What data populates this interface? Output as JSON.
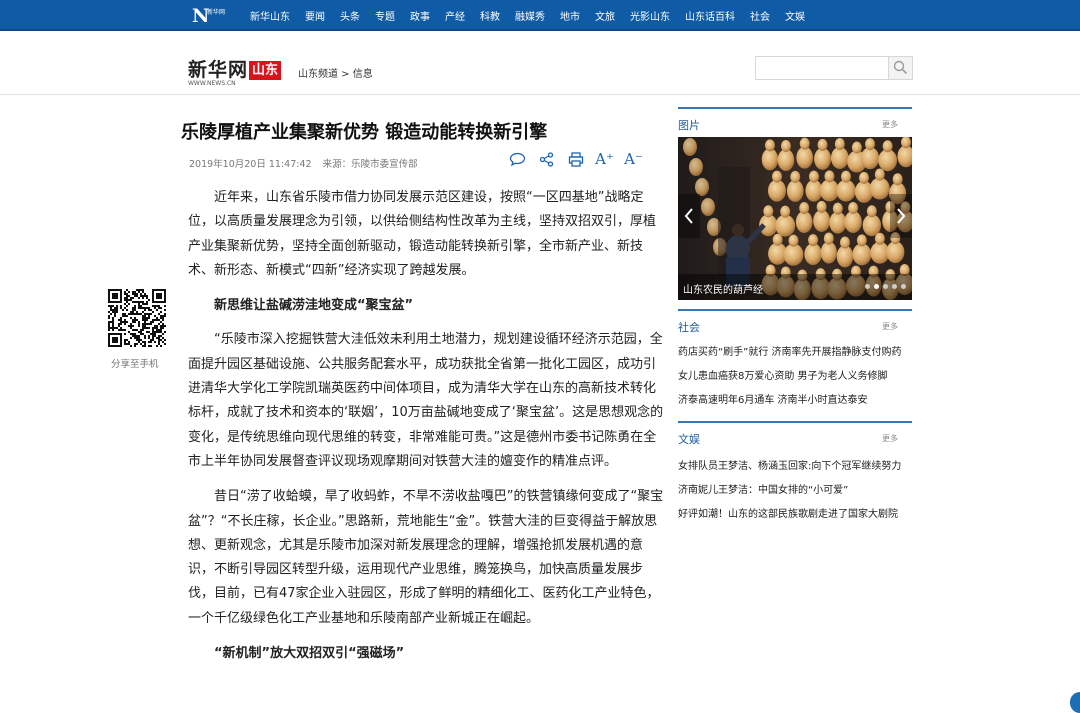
{
  "topnav": {
    "logo": {
      "mark": "N",
      "sub": "新华网"
    },
    "items": [
      "新华山东",
      "要闻",
      "头条",
      "专题",
      "政事",
      "产经",
      "科教",
      "融媒秀",
      "地市",
      "文旅",
      "光影山东",
      "山东话百科",
      "社会",
      "文娱"
    ]
  },
  "header": {
    "brand_cn": "新华网",
    "brand_region": "山东",
    "brand_url": "WWW.NEWS.CN",
    "breadcrumb": "山东频道 > 信息",
    "search_placeholder": "",
    "search_icon": "search-icon"
  },
  "article": {
    "title": "乐陵厚植产业集聚新优势 锻造动能转换新引擎",
    "date": "2019年10月20日 11:47:42",
    "source": "来源：乐陵市委宣传部",
    "tools": [
      "comment-icon",
      "share-icon",
      "print-icon",
      "font-larger-icon",
      "font-smaller-icon"
    ],
    "font_larger": "A⁺",
    "font_smaller": "A⁻",
    "paragraphs": [
      "近年来，山东省乐陵市借力协同发展示范区建设，按照“一区四基地”战略定位，以高质量发展理念为引领，以供给侧结构性改革为主线，坚持双招双引，厚植产业集聚新优势，坚持全面创新驱动，锻造动能转换新引擎，全市新产业、新技术、新形态、新模式“四新”经济实现了跨越发展。",
      "新思维让盐碱涝洼地变成“聚宝盆”",
      "“乐陵市深入挖掘铁营大洼低效未利用土地潜力，规划建设循环经济示范园，全面提升园区基础设施、公共服务配套水平，成功获批全省第一批化工园区，成功引进清华大学化工学院凯瑞英医药中间体项目，成为清华大学在山东的高新技术转化标杆，成就了技术和资本的‘联姻’，10万亩盐碱地变成了‘聚宝盆’。这是思想观念的变化，是传统思维向现代思维的转变，非常难能可贵。”这是德州市委书记陈勇在全市上半年协同发展督查评议现场观摩期间对铁营大洼的嬗变作的精准点评。",
      "昔日“涝了收蛤蟆，旱了收蚂蚱，不旱不涝收盐嘎巴”的铁营镇缘何变成了“聚宝盆”？“不长庄稼，长企业。”思路新，荒地能生“金”。铁营大洼的巨变得益于解放思想、更新观念，尤其是乐陵市加深对新发展理念的理解，增强抢抓发展机遇的意识，不断引导园区转型升级，运用现代产业思维，腾笼换鸟，加快高质量发展步伐，目前，已有47家企业入驻园区，形成了鲜明的精细化工、医药化工产业特色，一个千亿级绿色化工产业基地和乐陵南部产业新城正在崛起。",
      "“新机制”放大双招双引“强磁场”"
    ],
    "subheading_indices": [
      1,
      4
    ]
  },
  "qr": {
    "label": "分享至手机"
  },
  "sidebar": {
    "pictures": {
      "heading": "图片",
      "more": "更多",
      "caption": "山东农民的葫芦经",
      "slides": 5,
      "active_slide": 1
    },
    "society": {
      "heading": "社会",
      "more": "更多",
      "items": [
        "药店买药“刷手”就行 济南率先开展指静脉支付购药",
        "女儿患血癌获8万爱心资助 男子为老人义务修脚",
        "济泰高速明年6月通车 济南半小时直达泰安"
      ]
    },
    "entertainment": {
      "heading": "文娱",
      "more": "更多",
      "items": [
        "女排队员王梦洁、杨涵玉回家:向下个冠军继续努力",
        "济南妮儿王梦洁：中国女排的“小可爱”",
        "好评如潮！山东的这部民族歌剧走进了国家大剧院"
      ]
    }
  },
  "colors": {
    "nav_bg": "#0f5ba6",
    "brand_red": "#d8141b",
    "accent_blue": "#1c64b3",
    "section_rule": "#3b77b4"
  }
}
